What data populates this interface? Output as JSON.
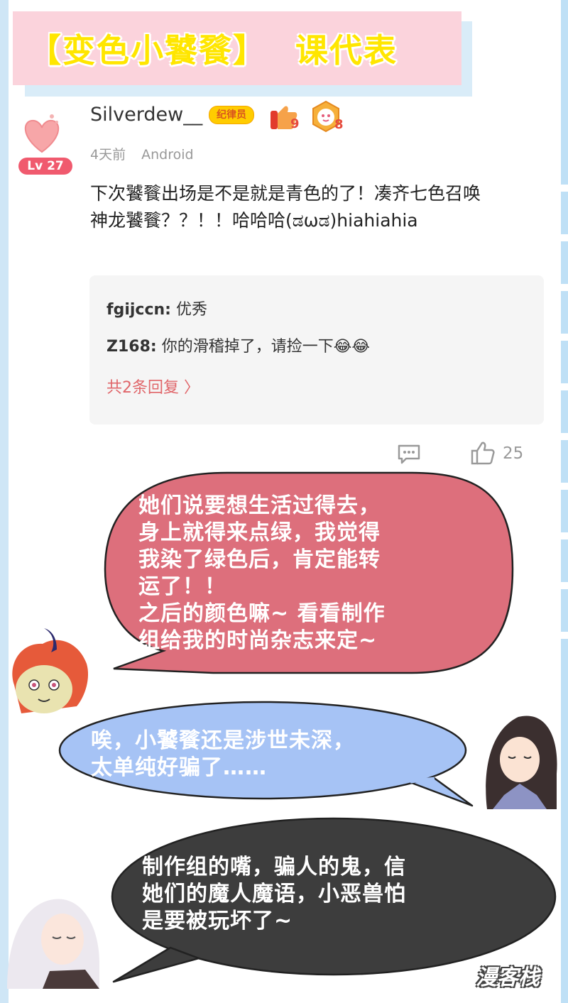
{
  "banner": {
    "title": "【变色小饕餮】",
    "subtitle": "课代表"
  },
  "comment": {
    "level": "Lv 27",
    "username": "Silverdew__",
    "role_badge": "纪律员",
    "medal_1_count": "9",
    "medal_2_count": "8",
    "time": "4天前",
    "device": "Android",
    "text": "下次饕餮出场是不是就是青色的了！凑齐七色召唤神龙饕餮？？！！哈哈哈(ಡωಡ)hiahiahia",
    "replies": [
      {
        "user": "fgijccn:",
        "text": "优秀"
      },
      {
        "user": "Z168:",
        "text": "你的滑稽掉了，请捡一下😂😂"
      }
    ],
    "more_replies": "共2条回复 〉",
    "like_count": "25",
    "icons": [
      "comment-icon",
      "thumbs-up-icon",
      "heart-icon"
    ]
  },
  "bubbles": [
    {
      "text": "她们说要想生活过得去，\n身上就得来点绿，我觉得\n我染了绿色后，肯定能转\n运了！！\n之后的颜色嘛~ 看看制作\n组给我的时尚杂志来定~",
      "color": "#dd6f7c"
    },
    {
      "text": "唉，小饕餮还是涉世未深，\n太单纯好骗了……",
      "color": "#a6c3f5"
    },
    {
      "text": "制作组的嘴，骗人的鬼，信\n她们的魔人魔语，小恶兽怕\n是要被玩坏了~",
      "color": "#3d3d3d"
    }
  ],
  "watermark": "漫客栈",
  "colors": {
    "banner_bg": "#fbd3dc",
    "banner_text": "#ffe600",
    "accent": "#f05a6e",
    "frame": "#cfe6f6"
  }
}
